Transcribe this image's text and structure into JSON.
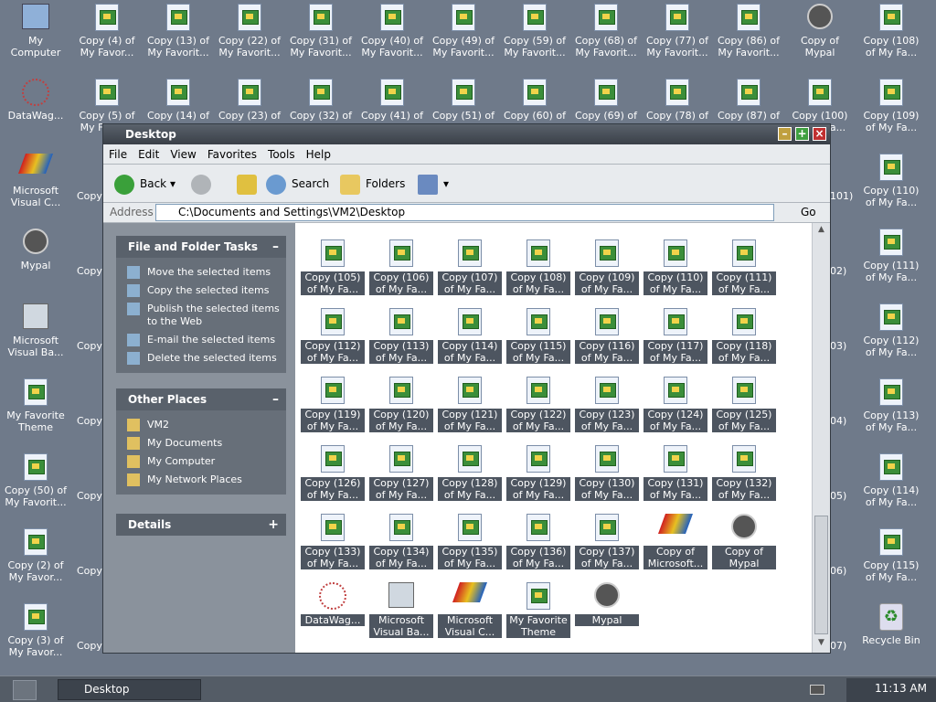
{
  "desktop": {
    "icons": [
      {
        "label": "My\nComputer",
        "kind": "computer"
      },
      {
        "label": "Copy (4) of\nMy Favor...",
        "kind": "doc"
      },
      {
        "label": "Copy (13) of\nMy Favorit...",
        "kind": "doc"
      },
      {
        "label": "Copy (22) of\nMy Favorit...",
        "kind": "doc"
      },
      {
        "label": "Copy (31) of\nMy Favorit...",
        "kind": "doc"
      },
      {
        "label": "Copy (40) of\nMy Favorit...",
        "kind": "doc"
      },
      {
        "label": "Copy (49) of\nMy Favorit...",
        "kind": "doc"
      },
      {
        "label": "Copy (59) of\nMy Favorit...",
        "kind": "doc"
      },
      {
        "label": "Copy (68) of\nMy Favorit...",
        "kind": "doc"
      },
      {
        "label": "Copy (77) of\nMy Favorit...",
        "kind": "doc"
      },
      {
        "label": "Copy (86) of\nMy Favorit...",
        "kind": "doc"
      },
      {
        "label": "Copy of\nMypal",
        "kind": "raccoon"
      },
      {
        "label": "Copy (108)\nof My Fa...",
        "kind": "doc"
      },
      {
        "label": "DataWag...",
        "kind": "molecule"
      },
      {
        "label": "Copy (5) of\nMy Favor...",
        "kind": "doc"
      },
      {
        "label": "Copy (14) of\nMy Favorit...",
        "kind": "doc"
      },
      {
        "label": "Copy (23) of\nMy Favorit...",
        "kind": "doc"
      },
      {
        "label": "Copy (32) of\nMy Favorit...",
        "kind": "doc"
      },
      {
        "label": "Copy (41) of\nMy Favorit...",
        "kind": "doc"
      },
      {
        "label": "Copy (51) of\nMy Favorit...",
        "kind": "doc"
      },
      {
        "label": "Copy (60) of\nMy Favorit...",
        "kind": "doc"
      },
      {
        "label": "Copy (69) of\nMy Favorit...",
        "kind": "doc"
      },
      {
        "label": "Copy (78) of\nMy Favorit...",
        "kind": "doc"
      },
      {
        "label": "Copy (87) of\nMy Favorit...",
        "kind": "doc"
      },
      {
        "label": "Copy (100)\nof My Fa...",
        "kind": "doc"
      },
      {
        "label": "Copy (109)\nof My Fa...",
        "kind": "doc"
      },
      {
        "label": "Microsoft\nVisual C...",
        "kind": "vc"
      },
      {
        "label": "Copy (110)\nof My Fa...",
        "kind": "doc"
      },
      {
        "label": "Mypal",
        "kind": "raccoon"
      },
      {
        "label": "Copy (111)\nof My Fa...",
        "kind": "doc"
      },
      {
        "label": "Microsoft\nVisual Ba...",
        "kind": "vb"
      },
      {
        "label": "Copy (112)\nof My Fa...",
        "kind": "doc"
      },
      {
        "label": "My Favorite\nTheme",
        "kind": "doc"
      },
      {
        "label": "Copy (113)\nof My Fa...",
        "kind": "doc"
      },
      {
        "label": "Copy (50) of\nMy Favorit...",
        "kind": "doc"
      },
      {
        "label": "Copy (114)\nof My Fa...",
        "kind": "doc"
      },
      {
        "label": "Copy (2) of\nMy Favor...",
        "kind": "doc"
      },
      {
        "label": "Copy (115)\nof My Fa...",
        "kind": "doc"
      },
      {
        "label": "Copy (3) of\nMy Favor...",
        "kind": "doc"
      },
      {
        "label": "Recycle Bin",
        "kind": "recycle"
      }
    ],
    "partial_labels": [
      "Copy",
      "Copy",
      "Copy",
      "Copy",
      "Copy",
      "Copy",
      "Copy",
      "101)",
      "02)",
      "03)",
      "04)",
      "05)",
      "06)",
      "07)"
    ]
  },
  "window": {
    "title": "Desktop",
    "menu": [
      "File",
      "Edit",
      "View",
      "Favorites",
      "Tools",
      "Help"
    ],
    "toolbar": {
      "back": "Back",
      "search": "Search",
      "folders": "Folders"
    },
    "address": {
      "label": "Address",
      "value": "C:\\Documents and Settings\\VM2\\Desktop",
      "go": "Go"
    },
    "tasks": {
      "title": "File and Folder Tasks",
      "items": [
        "Move the selected items",
        "Copy the selected items",
        "Publish the selected items\nto the Web",
        "E-mail the selected items",
        "Delete the selected items"
      ]
    },
    "places": {
      "title": "Other Places",
      "items": [
        "VM2",
        "My Documents",
        "My Computer",
        "My Network Places"
      ]
    },
    "details": {
      "title": "Details"
    },
    "files": [
      "Copy (105)\nof My Fa...",
      "Copy (106)\nof My Fa...",
      "Copy (107)\nof My Fa...",
      "Copy (108)\nof My Fa...",
      "Copy (109)\nof My Fa...",
      "Copy (110)\nof My Fa...",
      "Copy (111)\nof My Fa...",
      "Copy (112)\nof My Fa...",
      "Copy (113)\nof My Fa...",
      "Copy (114)\nof My Fa...",
      "Copy (115)\nof My Fa...",
      "Copy (116)\nof My Fa...",
      "Copy (117)\nof My Fa...",
      "Copy (118)\nof My Fa...",
      "Copy (119)\nof My Fa...",
      "Copy (120)\nof My Fa...",
      "Copy (121)\nof My Fa...",
      "Copy (122)\nof My Fa...",
      "Copy (123)\nof My Fa...",
      "Copy (124)\nof My Fa...",
      "Copy (125)\nof My Fa...",
      "Copy (126)\nof My Fa...",
      "Copy (127)\nof My Fa...",
      "Copy (128)\nof My Fa...",
      "Copy (129)\nof My Fa...",
      "Copy (130)\nof My Fa...",
      "Copy (131)\nof My Fa...",
      "Copy (132)\nof My Fa...",
      "Copy (133)\nof My Fa...",
      "Copy (134)\nof My Fa...",
      "Copy (135)\nof My Fa...",
      "Copy (136)\nof My Fa...",
      "Copy (137)\nof My Fa...",
      "Copy of\nMicrosoft...",
      "Copy of\nMypal",
      "DataWag...",
      "Microsoft\nVisual Ba...",
      "Microsoft\nVisual C...",
      "My Favorite\nTheme",
      "Mypal"
    ],
    "file_kinds": [
      "doc",
      "doc",
      "doc",
      "doc",
      "doc",
      "doc",
      "doc",
      "doc",
      "doc",
      "doc",
      "doc",
      "doc",
      "doc",
      "doc",
      "doc",
      "doc",
      "doc",
      "doc",
      "doc",
      "doc",
      "doc",
      "doc",
      "doc",
      "doc",
      "doc",
      "doc",
      "doc",
      "doc",
      "doc",
      "doc",
      "doc",
      "doc",
      "doc",
      "vc",
      "raccoon",
      "molecule",
      "vb",
      "vc",
      "doc",
      "raccoon"
    ]
  },
  "taskbar": {
    "task": "Desktop",
    "clock": "11:13 AM"
  }
}
